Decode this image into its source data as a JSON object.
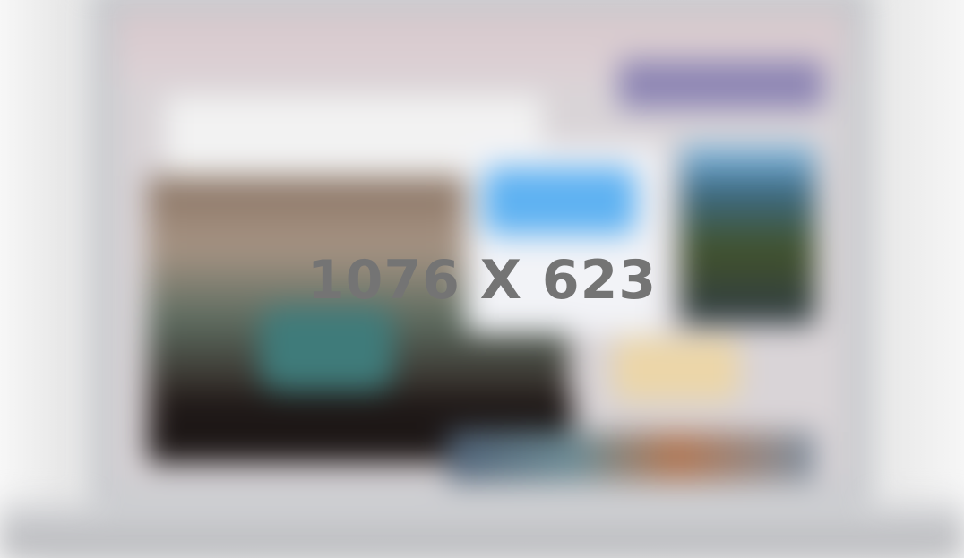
{
  "placeholder": {
    "label": "1076 X 623"
  },
  "colors": {
    "background": "#f3f3f3",
    "lid": "#c7c9cd",
    "screen": "#d9d4d7",
    "hero_light": "#f2f2f2",
    "center_card_blue": "#5fb2f2",
    "yellow_box": "#ecd6a8",
    "label_text": "#747474"
  }
}
